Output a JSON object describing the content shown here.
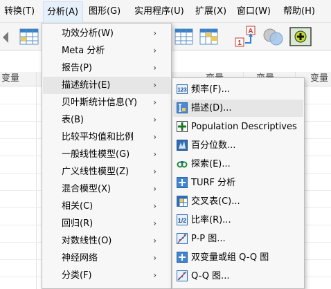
{
  "menubar": {
    "items": [
      {
        "label": "转换(T)"
      },
      {
        "label": "分析(A)"
      },
      {
        "label": "图形(G)"
      },
      {
        "label": "实用程序(U)"
      },
      {
        "label": "扩展(X)"
      },
      {
        "label": "窗口(W)"
      },
      {
        "label": "帮助(H)"
      }
    ]
  },
  "grid": {
    "headers": [
      "变量",
      "变量",
      "变量",
      "变量"
    ]
  },
  "analyze_menu": {
    "items": [
      {
        "label": "功效分析(W)",
        "submenu": true
      },
      {
        "label": "Meta 分析",
        "submenu": true
      },
      {
        "label": "报告(P)",
        "submenu": true
      },
      {
        "label": "描述统计(E)",
        "submenu": true,
        "highlighted": true
      },
      {
        "label": "贝叶斯统计信息(Y)",
        "submenu": true
      },
      {
        "label": "表(B)",
        "submenu": true
      },
      {
        "label": "比较平均值和比例",
        "submenu": true
      },
      {
        "label": "一般线性模型(G)",
        "submenu": true
      },
      {
        "label": "广义线性模型(Z)",
        "submenu": true
      },
      {
        "label": "混合模型(X)",
        "submenu": true
      },
      {
        "label": "相关(C)",
        "submenu": true
      },
      {
        "label": "回归(R)",
        "submenu": true
      },
      {
        "label": "对数线性(O)",
        "submenu": true
      },
      {
        "label": "神经网络",
        "submenu": true
      },
      {
        "label": "分类(F)",
        "submenu": true
      }
    ],
    "arrow_glyph": "›"
  },
  "descriptive_submenu": {
    "items": [
      {
        "label": "频率(F)...",
        "icon": "frequencies-icon"
      },
      {
        "label": "描述(D)...",
        "icon": "descriptives-icon",
        "highlighted": true
      },
      {
        "label": "Population Descriptives",
        "icon": "population-descriptives-icon"
      },
      {
        "label": "百分位数...",
        "icon": "percentiles-icon"
      },
      {
        "label": "探索(E)...",
        "icon": "explore-icon"
      },
      {
        "label": "TURF 分析",
        "icon": "turf-icon"
      },
      {
        "label": "交叉表(C)...",
        "icon": "crosstabs-icon"
      },
      {
        "label": "比率(R)...",
        "icon": "ratio-icon"
      },
      {
        "label": "P-P 图...",
        "icon": "pp-plot-icon"
      },
      {
        "label": "双变量或组 Q-Q 图",
        "icon": "bivariate-qq-icon"
      },
      {
        "label": "Q-Q 图...",
        "icon": "qq-plot-icon"
      }
    ]
  },
  "colors": {
    "menu_bg": "#f7f7f7",
    "highlight": "#e6e6e6",
    "active_menu": "#e5f0fb",
    "accent_blue": "#2f7fd0",
    "accent_green": "#2d9a3a"
  }
}
